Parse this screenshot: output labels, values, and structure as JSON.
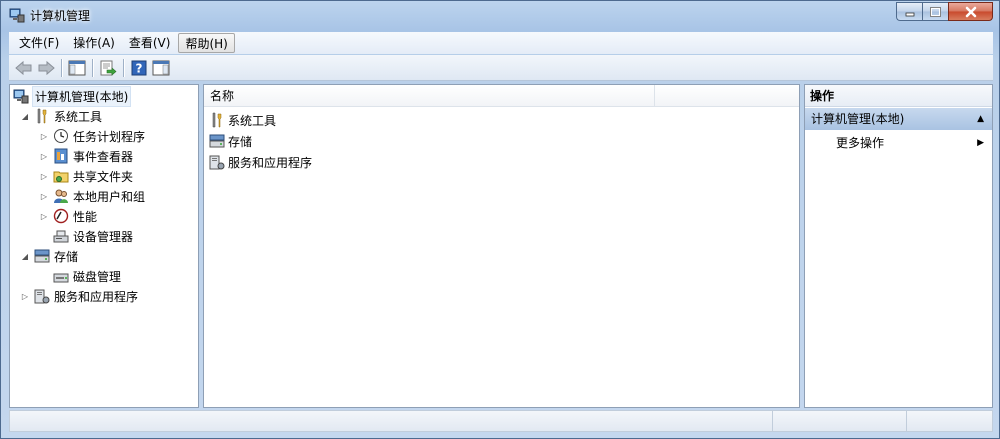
{
  "window": {
    "title": "计算机管理"
  },
  "menu": [
    {
      "label": "文件(F)"
    },
    {
      "label": "操作(A)"
    },
    {
      "label": "查看(V)"
    },
    {
      "label": "帮助(H)"
    }
  ],
  "toolbar": {
    "buttons": [
      "back-icon",
      "forward-icon",
      "show-hide-tree-icon",
      "export-list-icon",
      "help-icon",
      "show-hide-action-pane-icon"
    ]
  },
  "tree": {
    "root": "计算机管理(本地)",
    "system_tools": "系统工具",
    "task_scheduler": "任务计划程序",
    "event_viewer": "事件查看器",
    "shared_folders": "共享文件夹",
    "local_users": "本地用户和组",
    "performance": "性能",
    "device_manager": "设备管理器",
    "storage": "存储",
    "disk_management": "磁盘管理",
    "services_apps": "服务和应用程序"
  },
  "main": {
    "column_name": "名称",
    "items": [
      "系统工具",
      "存储",
      "服务和应用程序"
    ]
  },
  "actions": {
    "header": "操作",
    "section": "计算机管理(本地)",
    "more": "更多操作"
  },
  "colors": {
    "selection_bg": "#eaf2fb",
    "action_section": "#b9cfe9",
    "close_button": "#c8492c"
  }
}
